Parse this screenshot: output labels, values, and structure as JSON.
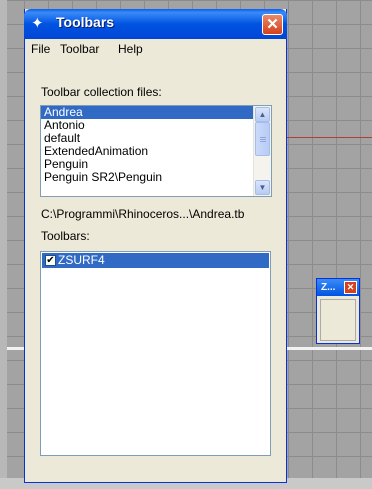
{
  "window": {
    "title": "Toolbars",
    "close_symbol": "✕",
    "icon": "rhino-icon"
  },
  "menu": {
    "items": [
      "File",
      "Toolbar",
      "Help"
    ]
  },
  "collection": {
    "label": "Toolbar collection files:",
    "files": [
      "Andrea",
      "Antonio",
      "default",
      "ExtendedAnimation",
      "Penguin",
      "Penguin SR2\\Penguin"
    ],
    "selected_index": 0,
    "path": "C:\\Programmi\\Rhinoceros...\\Andrea.tb"
  },
  "toolbars": {
    "label": "Toolbars:",
    "items": [
      {
        "name": "ZSURF4",
        "checked": true
      }
    ]
  },
  "floating_toolbar": {
    "title": "Z...",
    "close_symbol": "✕"
  },
  "colors": {
    "title_bar": "#0053e1",
    "selection": "#316ac5",
    "dialog_bg": "#ece9d8"
  }
}
